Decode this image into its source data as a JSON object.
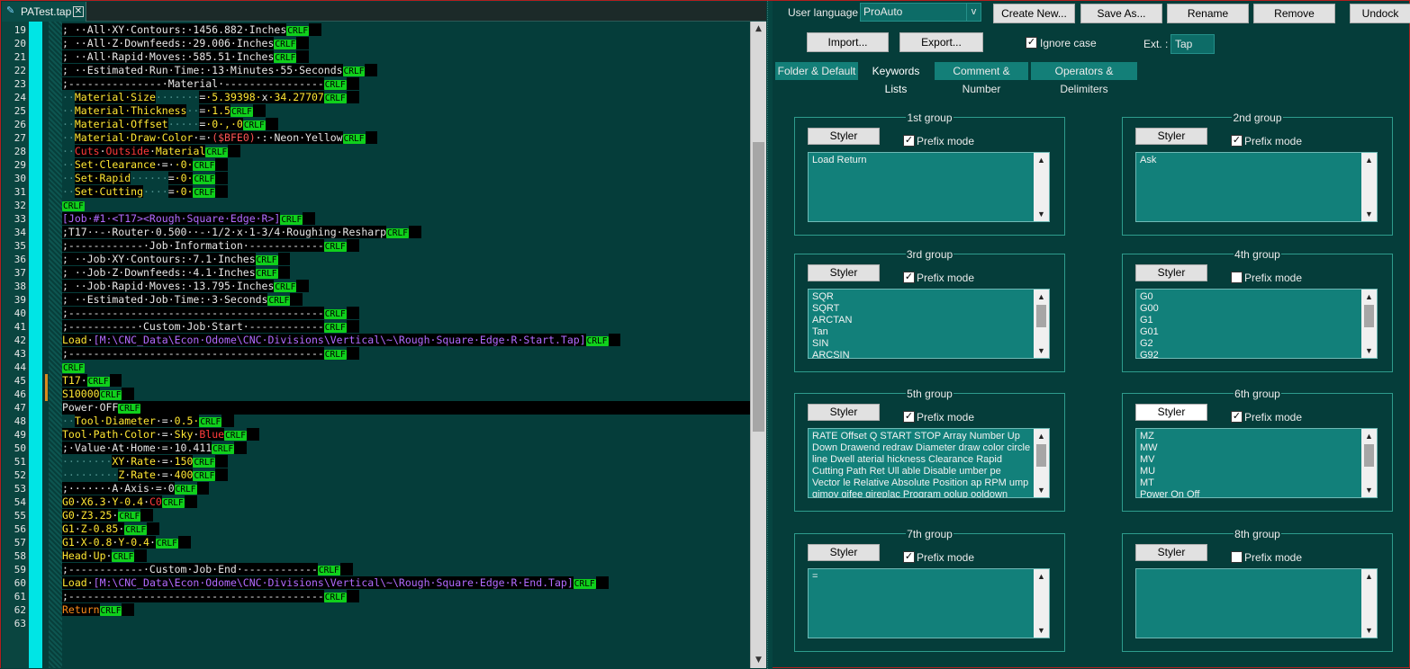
{
  "editor": {
    "tab_title": "PATest.tap",
    "tab_close": "✕",
    "first_line_number": 19,
    "crlf_label": "CRLF",
    "lines": [
      [
        {
          "t": "; ··All·XY·Contours:·1456.882·Inches",
          "c": "#e6e6e6"
        }
      ],
      [
        {
          "t": "; ··All·Z·Downfeeds:·29.006·Inches",
          "c": "#e6e6e6"
        }
      ],
      [
        {
          "t": "; ··All·Rapid·Moves:·585.51·Inches",
          "c": "#e6e6e6"
        }
      ],
      [
        {
          "t": "; ··Estimated·Run·Time:·13·Minutes·55·Seconds",
          "c": "#e6e6e6"
        }
      ],
      [
        {
          "t": ";---------------·Material·----------------",
          "c": "#e6e6e6"
        }
      ],
      [
        {
          "t": "··",
          "c": "#4b8d89",
          "nb": 1
        },
        {
          "t": "Material·Size",
          "c": "#ffe733"
        },
        {
          "t": "·······",
          "c": "#4b8d89",
          "nb": 1
        },
        {
          "t": "=",
          "c": "#e6e6e6"
        },
        {
          "t": "·5.39398·",
          "c": "#ffe733"
        },
        {
          "t": "x",
          "c": "#e6e6e6"
        },
        {
          "t": "·34.27707",
          "c": "#ffe733"
        }
      ],
      [
        {
          "t": "··",
          "c": "#4b8d89",
          "nb": 1
        },
        {
          "t": "Material·Thickness",
          "c": "#ffe733"
        },
        {
          "t": "··",
          "c": "#4b8d89",
          "nb": 1
        },
        {
          "t": "=",
          "c": "#e6e6e6"
        },
        {
          "t": "·1.5",
          "c": "#ffe733"
        }
      ],
      [
        {
          "t": "··",
          "c": "#4b8d89",
          "nb": 1
        },
        {
          "t": "Material·Offset",
          "c": "#ffe733"
        },
        {
          "t": "·····",
          "c": "#4b8d89",
          "nb": 1
        },
        {
          "t": "=",
          "c": "#e6e6e6"
        },
        {
          "t": "·0·,·0",
          "c": "#ffe733"
        }
      ],
      [
        {
          "t": "··",
          "c": "#4b8d89",
          "nb": 1
        },
        {
          "t": "Material·Draw·Color",
          "c": "#ffe733"
        },
        {
          "t": "·=·",
          "c": "#e6e6e6"
        },
        {
          "t": "($BFE0)",
          "c": "#ff5555"
        },
        {
          "t": "·:·Neon·Yellow",
          "c": "#e6e6e6"
        }
      ],
      [
        {
          "t": "··",
          "c": "#4b8d89",
          "nb": 1
        },
        {
          "t": "Cuts",
          "c": "#ff3b3b"
        },
        {
          "t": "·",
          "c": "#e6e6e6"
        },
        {
          "t": "Outside",
          "c": "#ff3b3b"
        },
        {
          "t": "·",
          "c": "#e6e6e6"
        },
        {
          "t": "Material",
          "c": "#ffe733"
        }
      ],
      [
        {
          "t": "··",
          "c": "#4b8d89",
          "nb": 1
        },
        {
          "t": "Set·Clearance",
          "c": "#ffe733"
        },
        {
          "t": "·=·",
          "c": "#e6e6e6"
        },
        {
          "t": "·0·",
          "c": "#ffe733"
        }
      ],
      [
        {
          "t": "··",
          "c": "#4b8d89",
          "nb": 1
        },
        {
          "t": "Set·Rapid",
          "c": "#ffe733"
        },
        {
          "t": "······",
          "c": "#4b8d89",
          "nb": 1
        },
        {
          "t": "=",
          "c": "#e6e6e6"
        },
        {
          "t": "·0·",
          "c": "#ffe733"
        }
      ],
      [
        {
          "t": "··",
          "c": "#4b8d89",
          "nb": 1
        },
        {
          "t": "Set·Cutting",
          "c": "#ffe733"
        },
        {
          "t": "····",
          "c": "#4b8d89",
          "nb": 1
        },
        {
          "t": "=",
          "c": "#e6e6e6"
        },
        {
          "t": "·0·",
          "c": "#ffe733"
        }
      ],
      [],
      [
        {
          "t": "[Job·#1·<T17><Rough·Square·Edge·R>]",
          "c": "#b26bff"
        }
      ],
      [
        {
          "t": ";T17··-·Router·0.500··-·1/2·x·1-3/4·Roughing·Resharp",
          "c": "#e6e6e6"
        }
      ],
      [
        {
          "t": ";------------·Job·Information·------------",
          "c": "#e6e6e6"
        }
      ],
      [
        {
          "t": "; ··Job·XY·Contours:·7.1·Inches",
          "c": "#e6e6e6"
        }
      ],
      [
        {
          "t": "; ··Job·Z·Downfeeds:·4.1·Inches",
          "c": "#e6e6e6"
        }
      ],
      [
        {
          "t": "; ··Job·Rapid·Moves:·13.795·Inches",
          "c": "#e6e6e6"
        }
      ],
      [
        {
          "t": "; ··Estimated·Job·Time:·3·Seconds",
          "c": "#e6e6e6"
        }
      ],
      [
        {
          "t": ";-----------------------------------------",
          "c": "#e6e6e6"
        }
      ],
      [
        {
          "t": ";-----------·Custom·Job·Start·------------",
          "c": "#e6e6e6"
        }
      ],
      [
        {
          "t": "Load",
          "c": "#ffe733"
        },
        {
          "t": "·",
          "c": "#e6e6e6"
        },
        {
          "t": "[M:\\CNC_Data\\Econ·Odome\\CNC·Divisions\\Vertical\\~\\Rough·Square·Edge·R·Start.Tap]",
          "c": "#b26bff"
        }
      ],
      [
        {
          "t": ";-----------------------------------------",
          "c": "#e6e6e6"
        }
      ],
      [],
      [
        {
          "t": "T17",
          "c": "#ffe733"
        },
        {
          "t": "·",
          "c": "#e6e6e6"
        }
      ],
      [
        {
          "t": "S10000",
          "c": "#ffe733"
        }
      ],
      [
        {
          "t": "Power",
          "c": "#e6e6e6"
        },
        {
          "t": "·",
          "c": "#e6e6e6"
        },
        {
          "t": "OFF",
          "c": "#e6e6e6"
        }
      ],
      [
        {
          "t": "··",
          "c": "#4b8d89",
          "nb": 1
        },
        {
          "t": "Tool·Diameter",
          "c": "#ffe733"
        },
        {
          "t": "·=·",
          "c": "#e6e6e6"
        },
        {
          "t": "0.5·",
          "c": "#ffe733"
        }
      ],
      [
        {
          "t": "Tool·Path·Color",
          "c": "#ffe733"
        },
        {
          "t": "·=·",
          "c": "#e6e6e6"
        },
        {
          "t": "Sky",
          "c": "#ffe733"
        },
        {
          "t": "·",
          "c": "#e6e6e6"
        },
        {
          "t": "Blue",
          "c": "#ff3b3b"
        }
      ],
      [
        {
          "t": ";·Value·At·Home·=·10.411",
          "c": "#e6e6e6"
        }
      ],
      [
        {
          "t": "········",
          "c": "#4b8d89",
          "nb": 1
        },
        {
          "t": "XY",
          "c": "#ffe733"
        },
        {
          "t": "·",
          "c": "#e6e6e6"
        },
        {
          "t": "Rate",
          "c": "#ffe733"
        },
        {
          "t": "·=·",
          "c": "#e6e6e6"
        },
        {
          "t": "150",
          "c": "#ffe733"
        }
      ],
      [
        {
          "t": "·········",
          "c": "#4b8d89",
          "nb": 1
        },
        {
          "t": "Z",
          "c": "#ffe733"
        },
        {
          "t": "·",
          "c": "#e6e6e6"
        },
        {
          "t": "Rate",
          "c": "#ffe733"
        },
        {
          "t": "·=·",
          "c": "#e6e6e6"
        },
        {
          "t": "400",
          "c": "#ffe733"
        }
      ],
      [
        {
          "t": ";·······A·Axis·=·0",
          "c": "#e6e6e6"
        }
      ],
      [
        {
          "t": "G0",
          "c": "#ffe733"
        },
        {
          "t": "·",
          "c": "#e6e6e6"
        },
        {
          "t": "X6.3",
          "c": "#ffe733"
        },
        {
          "t": "·",
          "c": "#e6e6e6"
        },
        {
          "t": "Y-0.4",
          "c": "#ffe733"
        },
        {
          "t": "·",
          "c": "#e6e6e6"
        },
        {
          "t": "C0",
          "c": "#ff3b3b"
        }
      ],
      [
        {
          "t": "G0",
          "c": "#ffe733"
        },
        {
          "t": "·",
          "c": "#e6e6e6"
        },
        {
          "t": "Z3.25",
          "c": "#ffe733"
        },
        {
          "t": "·",
          "c": "#e6e6e6"
        }
      ],
      [
        {
          "t": "G1",
          "c": "#ffe733"
        },
        {
          "t": "·",
          "c": "#e6e6e6"
        },
        {
          "t": "Z-0.85",
          "c": "#ffe733"
        },
        {
          "t": "·",
          "c": "#e6e6e6"
        }
      ],
      [
        {
          "t": "G1",
          "c": "#ffe733"
        },
        {
          "t": "·",
          "c": "#e6e6e6"
        },
        {
          "t": "X-0.8",
          "c": "#ffe733"
        },
        {
          "t": "·",
          "c": "#e6e6e6"
        },
        {
          "t": "Y-0.4",
          "c": "#ffe733"
        },
        {
          "t": "·",
          "c": "#e6e6e6"
        }
      ],
      [
        {
          "t": "Head",
          "c": "#ffe733"
        },
        {
          "t": "·",
          "c": "#e6e6e6"
        },
        {
          "t": "Up",
          "c": "#ffe733"
        },
        {
          "t": "·",
          "c": "#e6e6e6"
        }
      ],
      [
        {
          "t": ";------------·Custom·Job·End·------------",
          "c": "#e6e6e6"
        }
      ],
      [
        {
          "t": "Load",
          "c": "#ffe733"
        },
        {
          "t": "·",
          "c": "#e6e6e6"
        },
        {
          "t": "[M:\\CNC_Data\\Econ·Odome\\CNC·Divisions\\Vertical\\~\\Rough·Square·Edge·R·End.Tap]",
          "c": "#b26bff"
        }
      ],
      [
        {
          "t": ";-----------------------------------------",
          "c": "#e6e6e6"
        }
      ],
      [
        {
          "t": "Return",
          "c": "#ff8c1a"
        }
      ],
      []
    ],
    "no_crlf_last": true,
    "current_line_index": 28,
    "modified_line_indices": [
      26,
      27
    ]
  },
  "settings": {
    "user_language_label": "User language :",
    "user_language_value": "ProAuto",
    "dropdown_arrow": "v",
    "buttons": {
      "create_new": "Create New...",
      "save_as": "Save As...",
      "rename": "Rename",
      "remove": "Remove",
      "undock": "Undock",
      "import": "Import...",
      "export": "Export..."
    },
    "ignore_case_label": "Ignore case",
    "ignore_case_checked": true,
    "ext_label": "Ext. :",
    "ext_value": "Tap",
    "tabs": [
      "Folder & Default",
      "Keywords Lists",
      "Comment & Number",
      "Operators & Delimiters"
    ],
    "active_tab": 1,
    "styler_label": "Styler",
    "prefix_label": "Prefix mode",
    "check_mark": "✓",
    "scroll_up": "▲",
    "scroll_down": "▼",
    "groups": [
      {
        "title": "1st group",
        "prefix": true,
        "text": "Load Return",
        "thumb": false,
        "styler_white": false
      },
      {
        "title": "2nd group",
        "prefix": true,
        "text": "Ask",
        "thumb": false,
        "styler_white": false
      },
      {
        "title": "3rd group",
        "prefix": true,
        "text": "SQR\nSQRT\nARCTAN\nTan\nSIN\nARCSIN",
        "thumb": true,
        "styler_white": false
      },
      {
        "title": "4th group",
        "prefix": false,
        "text": "G0\nG00\nG1\nG01\nG2\nG92",
        "thumb": true,
        "styler_white": false
      },
      {
        "title": "5th group",
        "prefix": true,
        "text": "RATE Offset Q START STOP Array Number Up Down Drawend redraw Diameter draw color circle line Dwell aterial hickness Clearance Rapid Cutting Path Ret Ull able Disable umber pe Vector le Relative Absolute Position ap RPM ump gimov gifee gireplac Program oolup ooldown",
        "thumb": true,
        "styler_white": false
      },
      {
        "title": "6th group",
        "prefix": true,
        "text": "MZ\nMW\nMV\nMU\nMT\nPower On Off",
        "thumb": true,
        "styler_white": true
      },
      {
        "title": "7th group",
        "prefix": true,
        "text": "=",
        "thumb": false,
        "styler_white": false
      },
      {
        "title": "8th group",
        "prefix": false,
        "text": "",
        "thumb": false,
        "styler_white": false
      }
    ]
  }
}
